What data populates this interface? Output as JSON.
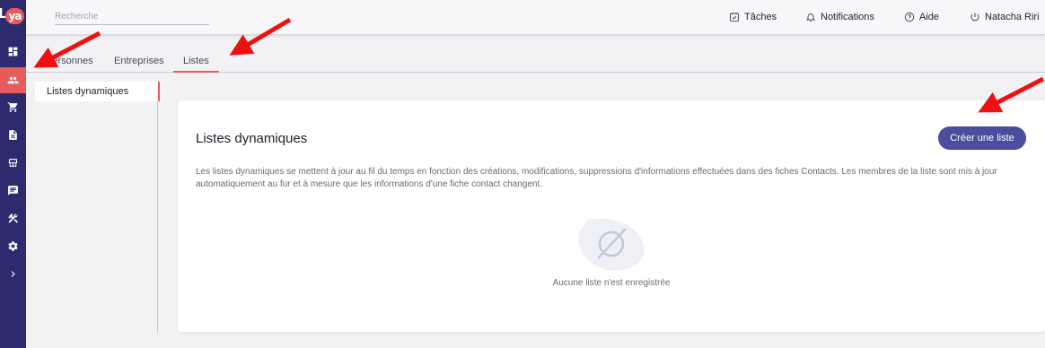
{
  "app": {
    "logo_text": "Lya"
  },
  "sidebar": {
    "items": [
      {
        "icon": "dashboard-icon"
      },
      {
        "icon": "contacts-icon",
        "active": true
      },
      {
        "icon": "cart-icon"
      },
      {
        "icon": "document-icon"
      },
      {
        "icon": "store-icon"
      },
      {
        "icon": "message-icon"
      },
      {
        "icon": "tools-icon"
      },
      {
        "icon": "settings-icon"
      },
      {
        "icon": "chevron-right-icon"
      }
    ]
  },
  "header": {
    "search_placeholder": "Recherche",
    "tasks_label": "Tâches",
    "notifications_label": "Notifications",
    "help_label": "Aide",
    "user_label": "Natacha Riri"
  },
  "tabs": [
    {
      "label": "Personnes"
    },
    {
      "label": "Entreprises"
    },
    {
      "label": "Listes",
      "active": true
    }
  ],
  "left_panel": {
    "items": [
      {
        "label": "Listes dynamiques",
        "active": true
      }
    ]
  },
  "card": {
    "title": "Listes dynamiques",
    "create_button": "Créer une liste",
    "description": "Les listes dynamiques se mettent à jour au fil du temps en fonction des créations, modifications, suppressions d'informations effectuées dans des fiches Contacts. Les membres de la liste sont mis à jour automatiquement au fur et à mesure que les informations d'une fiche contact changent.",
    "empty_text": "Aucune liste n'est enregistrée"
  },
  "colors": {
    "sidebar": "#2d2a6e",
    "accent": "#e65b5b",
    "button": "#4a4e9c",
    "annotation_arrow": "#ee1111"
  }
}
